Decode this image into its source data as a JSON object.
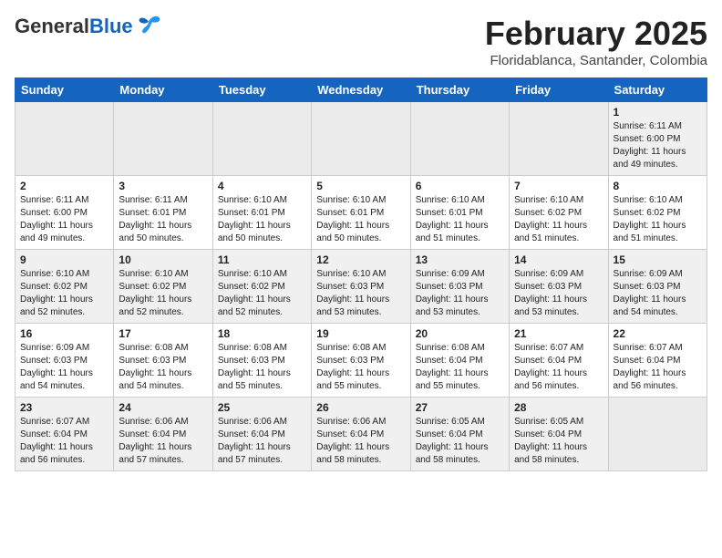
{
  "header": {
    "logo_general": "General",
    "logo_blue": "Blue",
    "month_title": "February 2025",
    "location": "Floridablanca, Santander, Colombia"
  },
  "days_of_week": [
    "Sunday",
    "Monday",
    "Tuesday",
    "Wednesday",
    "Thursday",
    "Friday",
    "Saturday"
  ],
  "weeks": [
    {
      "days": [
        {
          "num": "",
          "info": ""
        },
        {
          "num": "",
          "info": ""
        },
        {
          "num": "",
          "info": ""
        },
        {
          "num": "",
          "info": ""
        },
        {
          "num": "",
          "info": ""
        },
        {
          "num": "",
          "info": ""
        },
        {
          "num": "1",
          "info": "Sunrise: 6:11 AM\nSunset: 6:00 PM\nDaylight: 11 hours\nand 49 minutes."
        }
      ]
    },
    {
      "days": [
        {
          "num": "2",
          "info": "Sunrise: 6:11 AM\nSunset: 6:00 PM\nDaylight: 11 hours\nand 49 minutes."
        },
        {
          "num": "3",
          "info": "Sunrise: 6:11 AM\nSunset: 6:01 PM\nDaylight: 11 hours\nand 50 minutes."
        },
        {
          "num": "4",
          "info": "Sunrise: 6:10 AM\nSunset: 6:01 PM\nDaylight: 11 hours\nand 50 minutes."
        },
        {
          "num": "5",
          "info": "Sunrise: 6:10 AM\nSunset: 6:01 PM\nDaylight: 11 hours\nand 50 minutes."
        },
        {
          "num": "6",
          "info": "Sunrise: 6:10 AM\nSunset: 6:01 PM\nDaylight: 11 hours\nand 51 minutes."
        },
        {
          "num": "7",
          "info": "Sunrise: 6:10 AM\nSunset: 6:02 PM\nDaylight: 11 hours\nand 51 minutes."
        },
        {
          "num": "8",
          "info": "Sunrise: 6:10 AM\nSunset: 6:02 PM\nDaylight: 11 hours\nand 51 minutes."
        }
      ]
    },
    {
      "days": [
        {
          "num": "9",
          "info": "Sunrise: 6:10 AM\nSunset: 6:02 PM\nDaylight: 11 hours\nand 52 minutes."
        },
        {
          "num": "10",
          "info": "Sunrise: 6:10 AM\nSunset: 6:02 PM\nDaylight: 11 hours\nand 52 minutes."
        },
        {
          "num": "11",
          "info": "Sunrise: 6:10 AM\nSunset: 6:02 PM\nDaylight: 11 hours\nand 52 minutes."
        },
        {
          "num": "12",
          "info": "Sunrise: 6:10 AM\nSunset: 6:03 PM\nDaylight: 11 hours\nand 53 minutes."
        },
        {
          "num": "13",
          "info": "Sunrise: 6:09 AM\nSunset: 6:03 PM\nDaylight: 11 hours\nand 53 minutes."
        },
        {
          "num": "14",
          "info": "Sunrise: 6:09 AM\nSunset: 6:03 PM\nDaylight: 11 hours\nand 53 minutes."
        },
        {
          "num": "15",
          "info": "Sunrise: 6:09 AM\nSunset: 6:03 PM\nDaylight: 11 hours\nand 54 minutes."
        }
      ]
    },
    {
      "days": [
        {
          "num": "16",
          "info": "Sunrise: 6:09 AM\nSunset: 6:03 PM\nDaylight: 11 hours\nand 54 minutes."
        },
        {
          "num": "17",
          "info": "Sunrise: 6:08 AM\nSunset: 6:03 PM\nDaylight: 11 hours\nand 54 minutes."
        },
        {
          "num": "18",
          "info": "Sunrise: 6:08 AM\nSunset: 6:03 PM\nDaylight: 11 hours\nand 55 minutes."
        },
        {
          "num": "19",
          "info": "Sunrise: 6:08 AM\nSunset: 6:03 PM\nDaylight: 11 hours\nand 55 minutes."
        },
        {
          "num": "20",
          "info": "Sunrise: 6:08 AM\nSunset: 6:04 PM\nDaylight: 11 hours\nand 55 minutes."
        },
        {
          "num": "21",
          "info": "Sunrise: 6:07 AM\nSunset: 6:04 PM\nDaylight: 11 hours\nand 56 minutes."
        },
        {
          "num": "22",
          "info": "Sunrise: 6:07 AM\nSunset: 6:04 PM\nDaylight: 11 hours\nand 56 minutes."
        }
      ]
    },
    {
      "days": [
        {
          "num": "23",
          "info": "Sunrise: 6:07 AM\nSunset: 6:04 PM\nDaylight: 11 hours\nand 56 minutes."
        },
        {
          "num": "24",
          "info": "Sunrise: 6:06 AM\nSunset: 6:04 PM\nDaylight: 11 hours\nand 57 minutes."
        },
        {
          "num": "25",
          "info": "Sunrise: 6:06 AM\nSunset: 6:04 PM\nDaylight: 11 hours\nand 57 minutes."
        },
        {
          "num": "26",
          "info": "Sunrise: 6:06 AM\nSunset: 6:04 PM\nDaylight: 11 hours\nand 58 minutes."
        },
        {
          "num": "27",
          "info": "Sunrise: 6:05 AM\nSunset: 6:04 PM\nDaylight: 11 hours\nand 58 minutes."
        },
        {
          "num": "28",
          "info": "Sunrise: 6:05 AM\nSunset: 6:04 PM\nDaylight: 11 hours\nand 58 minutes."
        },
        {
          "num": "",
          "info": ""
        }
      ]
    }
  ]
}
